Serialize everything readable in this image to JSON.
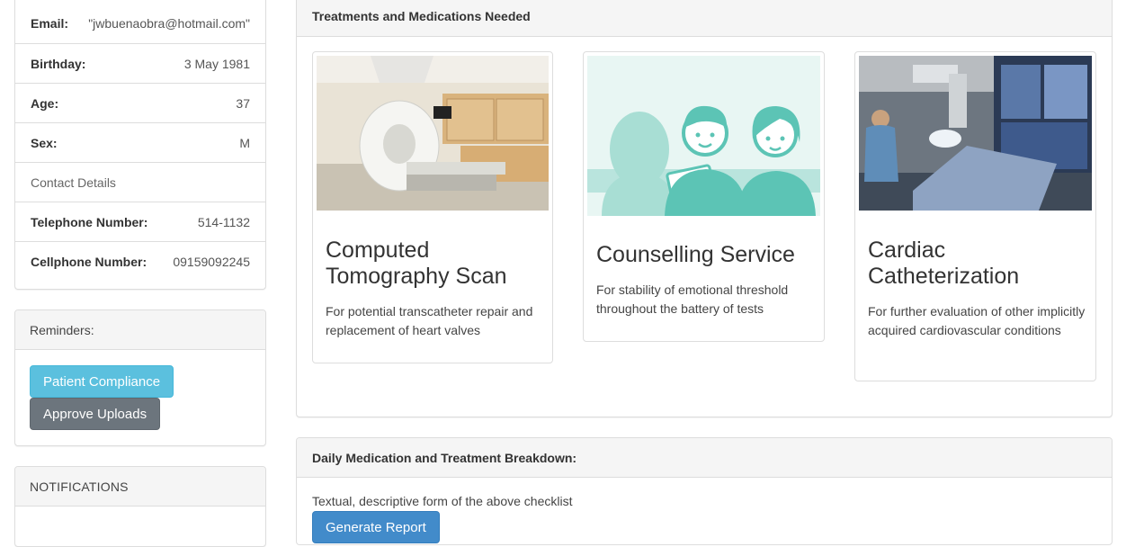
{
  "patient_info": {
    "rows": [
      {
        "key": "Email:",
        "value": "\"jwbuenaobra@hotmail.com\""
      },
      {
        "key": "Birthday:",
        "value": "3 May 1981"
      },
      {
        "key": "Age:",
        "value": "37"
      },
      {
        "key": "Sex:",
        "value": "M"
      },
      {
        "key": "Contact Details",
        "value": ""
      },
      {
        "key": "Telephone Number:",
        "value": "514-1132"
      },
      {
        "key": "Cellphone Number:",
        "value": "09159092245"
      }
    ]
  },
  "reminders": {
    "heading": "Reminders:",
    "patient_compliance": "Patient Compliance",
    "approve_uploads": "Approve Uploads"
  },
  "notifications": {
    "heading": "NOTIFICATIONS"
  },
  "treatments": {
    "heading": "Treatments and Medications Needed",
    "cards": [
      {
        "title": "Computed Tomography Scan",
        "description": "For potential transcatheter repair and replacement of heart valves",
        "image": "ct-scanner-room-image"
      },
      {
        "title": "Counselling Service",
        "description": "For stability of emotional threshold throughout the battery of tests",
        "image": "counselling-illustration"
      },
      {
        "title": "Cardiac Catheterization",
        "description": "For further evaluation of other implicitly acquired cardiovascular conditions",
        "image": "cath-lab-image"
      }
    ]
  },
  "breakdown": {
    "heading": "Daily Medication and Treatment Breakdown:",
    "text": "Textual, descriptive form of the above checklist",
    "button": "Generate Report"
  },
  "colors": {
    "info_button": "#5bc0de",
    "dark_button": "#6c757d",
    "primary_button": "#428bca",
    "illustration_teal": "#5cc4b5"
  }
}
